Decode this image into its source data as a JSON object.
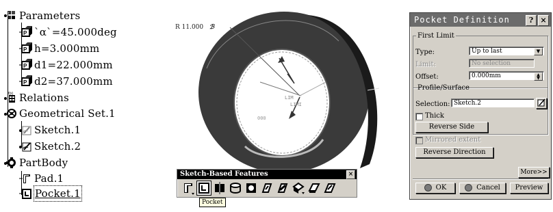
{
  "tree": {
    "nodes": [
      {
        "label": "Parameters"
      },
      {
        "label": "`α`=45.000deg"
      },
      {
        "label": "h=3.000mm"
      },
      {
        "label": "d1=22.000mm"
      },
      {
        "label": "d2=37.000mm"
      },
      {
        "label": "Relations"
      },
      {
        "label": "Geometrical Set.1"
      },
      {
        "label": "Sketch.1"
      },
      {
        "label": "Sketch.2"
      },
      {
        "label": "PartBody"
      },
      {
        "label": "Pad.1"
      },
      {
        "label": "Pocket.1"
      }
    ]
  },
  "view": {
    "dimension_label": "R 11.000",
    "limit_label_1": "LIM",
    "limit_label_2": "LIMI",
    "small_label": "000"
  },
  "toolbar": {
    "title": "Sketch-Based Features",
    "close": "×",
    "tooltip": "Pocket"
  },
  "dialog": {
    "title": "Pocket Definition",
    "help": "?",
    "close": "×",
    "first_limit": {
      "legend": "First Limit",
      "type_label": "Type:",
      "type_value": "Up to last",
      "limit_label": "Limit:",
      "limit_value": "No selection",
      "offset_label": "Offset:",
      "offset_value": "0.000mm"
    },
    "profile": {
      "legend": "Profile/Surface",
      "selection_label": "Selection:",
      "selection_value": "Sketch.2",
      "thick_label": "Thick",
      "reverse_side": "Reverse Side"
    },
    "mirrored_extent": "Mirrored extent",
    "reverse_direction": "Reverse Direction",
    "more": "More>>",
    "ok": "OK",
    "cancel": "Cancel",
    "preview": "Preview"
  }
}
